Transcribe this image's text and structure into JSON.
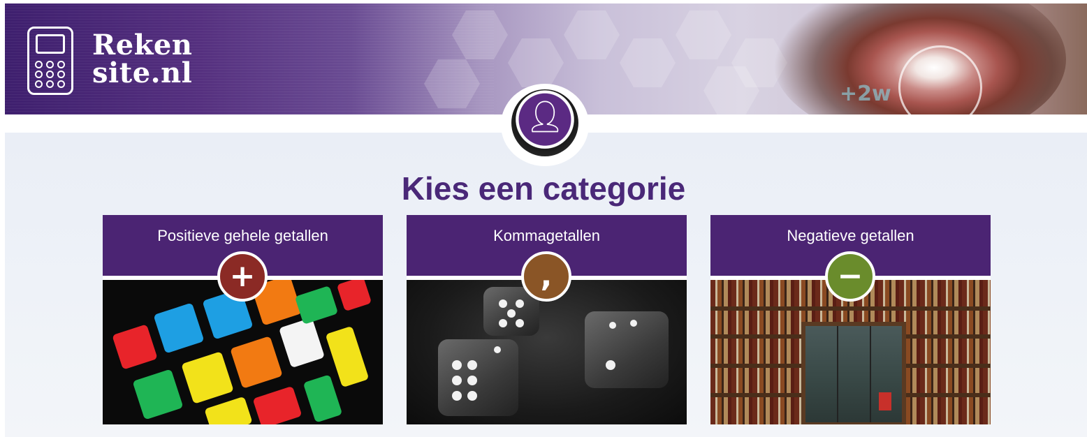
{
  "header": {
    "logo_line1": "Reken",
    "logo_line2": "site.nl",
    "banner_formula": "+2w"
  },
  "main": {
    "title": "Kies een categorie",
    "categories": [
      {
        "label": "Positieve gehele getallen",
        "badge_symbol": "+",
        "badge_icon": "plus-icon",
        "badge_color": "#8b2a25",
        "image": "rubiks-cube"
      },
      {
        "label": "Kommagetallen",
        "badge_symbol": ",",
        "badge_icon": "comma-icon",
        "badge_color": "#8a5526",
        "image": "dice"
      },
      {
        "label": "Negatieve getallen",
        "badge_symbol": "−",
        "badge_icon": "minus-icon",
        "badge_color": "#6a8c2c",
        "image": "bookshelves"
      }
    ]
  },
  "colors": {
    "brand_purple": "#4b2473",
    "title_purple": "#4a2878"
  }
}
